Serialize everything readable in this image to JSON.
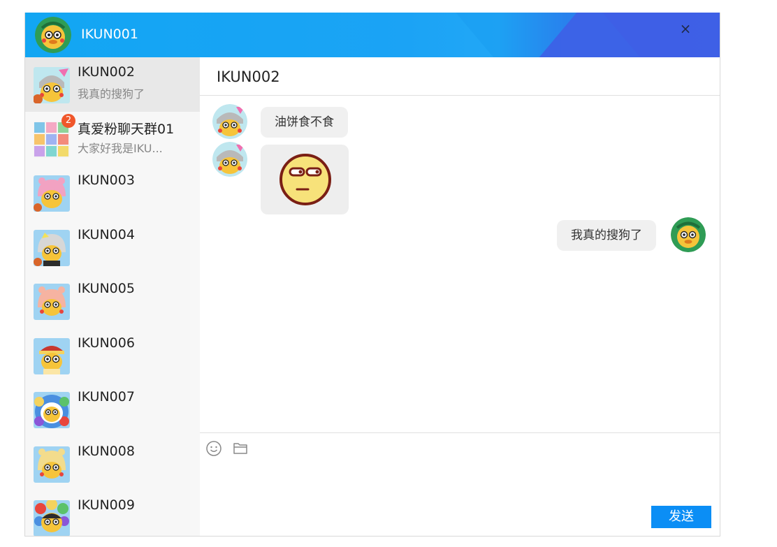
{
  "window": {
    "current_user": "IKUN001",
    "close_label": "×"
  },
  "contacts": [
    {
      "name": "IKUN002",
      "preview": "我真的搜狗了",
      "active": true,
      "badge": ""
    },
    {
      "name": "真爱粉聊天群01",
      "preview": "大家好我是IKU...",
      "active": false,
      "badge": "2"
    },
    {
      "name": "IKUN003",
      "preview": "",
      "active": false,
      "badge": ""
    },
    {
      "name": "IKUN004",
      "preview": "",
      "active": false,
      "badge": ""
    },
    {
      "name": "IKUN005",
      "preview": "",
      "active": false,
      "badge": ""
    },
    {
      "name": "IKUN006",
      "preview": "",
      "active": false,
      "badge": ""
    },
    {
      "name": "IKUN007",
      "preview": "",
      "active": false,
      "badge": ""
    },
    {
      "name": "IKUN008",
      "preview": "",
      "active": false,
      "badge": ""
    },
    {
      "name": "IKUN009",
      "preview": "",
      "active": false,
      "badge": ""
    }
  ],
  "chat": {
    "title": "IKUN002",
    "messages": [
      {
        "from": "IKUN002",
        "type": "text",
        "text": "油饼食不食"
      },
      {
        "from": "IKUN002",
        "type": "image",
        "icon": "smirk-emoji-icon"
      },
      {
        "from": "IKUN001",
        "type": "text",
        "text": "我真的搜狗了"
      }
    ]
  },
  "composer": {
    "send_label": "发送",
    "tools": [
      "emoji-icon",
      "folder-icon"
    ]
  },
  "colors": {
    "titlebar": "#12a6f3",
    "send_button": "#0b8ef5",
    "badge": "#f0562a"
  }
}
